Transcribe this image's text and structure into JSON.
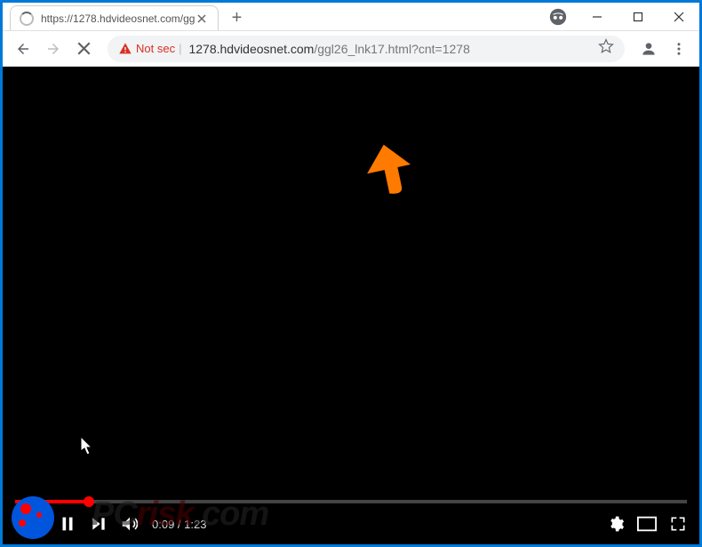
{
  "tab": {
    "title": "https://1278.hdvideosnet.com/gg"
  },
  "omnibox": {
    "security_text": "Not sec",
    "url_domain": "1278.hdvideosnet.com",
    "url_path": "/ggl26_lnk17.html?cnt=1278"
  },
  "video": {
    "current_time": "0:09",
    "duration": "1:23",
    "time_separator": " / "
  },
  "watermark": {
    "text_prefix": "PC",
    "text_mid": "risk",
    "text_suffix": ".com"
  }
}
